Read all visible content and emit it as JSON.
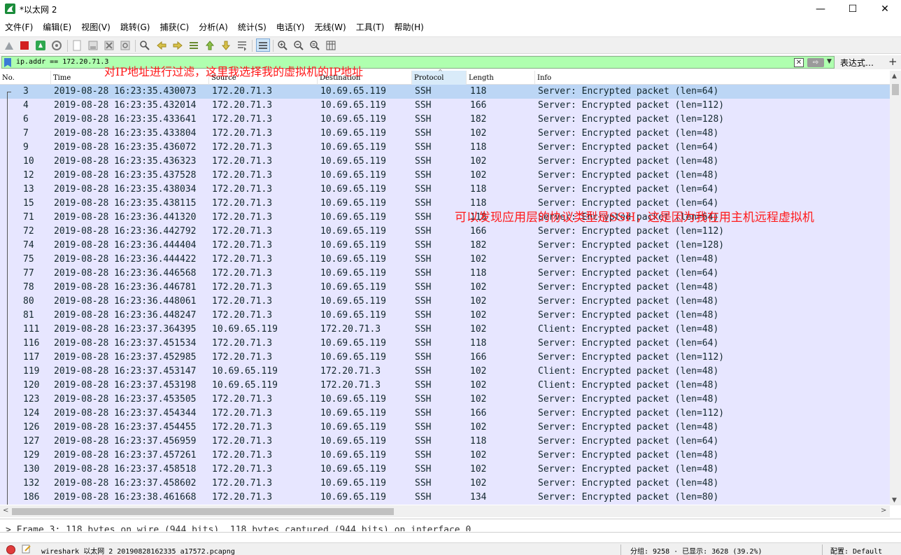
{
  "window": {
    "title": "*以太网 2",
    "min_glyph": "—",
    "max_glyph": "☐",
    "close_glyph": "✕"
  },
  "menu": [
    "文件(F)",
    "编辑(E)",
    "视图(V)",
    "跳转(G)",
    "捕获(C)",
    "分析(A)",
    "统计(S)",
    "电话(Y)",
    "无线(W)",
    "工具(T)",
    "帮助(H)"
  ],
  "toolbar": {
    "icons": [
      "shark-fin-start-icon",
      "stop-capture-icon",
      "restart-capture-icon",
      "capture-options-icon",
      "open-file-icon",
      "save-file-icon",
      "close-file-icon",
      "reload-file-icon",
      "find-packet-icon",
      "go-back-icon",
      "go-forward-icon",
      "go-to-packet-icon",
      "go-first-packet-icon",
      "go-last-packet-icon",
      "auto-scroll-icon",
      "colorize-icon",
      "zoom-in-icon",
      "zoom-out-icon",
      "zoom-normal-icon",
      "resize-columns-icon"
    ]
  },
  "filter": {
    "value": "ip.addr == 172.20.71.3",
    "clear_glyph": "✕",
    "apply_glyph": "⇨",
    "dropdown_glyph": "▼",
    "expression_label": "表达式…",
    "add_glyph": "+",
    "background_color": "#afffaf"
  },
  "columns": [
    "No.",
    "Time",
    "Source",
    "Destination",
    "Protocol",
    "Length",
    "Info"
  ],
  "packets": [
    {
      "no": "3",
      "time": "2019-08-28 16:23:35.430073",
      "src": "172.20.71.3",
      "dst": "10.69.65.119",
      "proto": "SSH",
      "len": "118",
      "info": "Server: Encrypted packet (len=64)"
    },
    {
      "no": "4",
      "time": "2019-08-28 16:23:35.432014",
      "src": "172.20.71.3",
      "dst": "10.69.65.119",
      "proto": "SSH",
      "len": "166",
      "info": "Server: Encrypted packet (len=112)"
    },
    {
      "no": "6",
      "time": "2019-08-28 16:23:35.433641",
      "src": "172.20.71.3",
      "dst": "10.69.65.119",
      "proto": "SSH",
      "len": "182",
      "info": "Server: Encrypted packet (len=128)"
    },
    {
      "no": "7",
      "time": "2019-08-28 16:23:35.433804",
      "src": "172.20.71.3",
      "dst": "10.69.65.119",
      "proto": "SSH",
      "len": "102",
      "info": "Server: Encrypted packet (len=48)"
    },
    {
      "no": "9",
      "time": "2019-08-28 16:23:35.436072",
      "src": "172.20.71.3",
      "dst": "10.69.65.119",
      "proto": "SSH",
      "len": "118",
      "info": "Server: Encrypted packet (len=64)"
    },
    {
      "no": "10",
      "time": "2019-08-28 16:23:35.436323",
      "src": "172.20.71.3",
      "dst": "10.69.65.119",
      "proto": "SSH",
      "len": "102",
      "info": "Server: Encrypted packet (len=48)"
    },
    {
      "no": "12",
      "time": "2019-08-28 16:23:35.437528",
      "src": "172.20.71.3",
      "dst": "10.69.65.119",
      "proto": "SSH",
      "len": "102",
      "info": "Server: Encrypted packet (len=48)"
    },
    {
      "no": "13",
      "time": "2019-08-28 16:23:35.438034",
      "src": "172.20.71.3",
      "dst": "10.69.65.119",
      "proto": "SSH",
      "len": "118",
      "info": "Server: Encrypted packet (len=64)"
    },
    {
      "no": "15",
      "time": "2019-08-28 16:23:35.438115",
      "src": "172.20.71.3",
      "dst": "10.69.65.119",
      "proto": "SSH",
      "len": "118",
      "info": "Server: Encrypted packet (len=64)"
    },
    {
      "no": "71",
      "time": "2019-08-28 16:23:36.441320",
      "src": "172.20.71.3",
      "dst": "10.69.65.119",
      "proto": "SSH",
      "len": "118",
      "info": "Server: Encrypted packet (len=64)"
    },
    {
      "no": "72",
      "time": "2019-08-28 16:23:36.442792",
      "src": "172.20.71.3",
      "dst": "10.69.65.119",
      "proto": "SSH",
      "len": "166",
      "info": "Server: Encrypted packet (len=112)"
    },
    {
      "no": "74",
      "time": "2019-08-28 16:23:36.444404",
      "src": "172.20.71.3",
      "dst": "10.69.65.119",
      "proto": "SSH",
      "len": "182",
      "info": "Server: Encrypted packet (len=128)"
    },
    {
      "no": "75",
      "time": "2019-08-28 16:23:36.444422",
      "src": "172.20.71.3",
      "dst": "10.69.65.119",
      "proto": "SSH",
      "len": "102",
      "info": "Server: Encrypted packet (len=48)"
    },
    {
      "no": "77",
      "time": "2019-08-28 16:23:36.446568",
      "src": "172.20.71.3",
      "dst": "10.69.65.119",
      "proto": "SSH",
      "len": "118",
      "info": "Server: Encrypted packet (len=64)"
    },
    {
      "no": "78",
      "time": "2019-08-28 16:23:36.446781",
      "src": "172.20.71.3",
      "dst": "10.69.65.119",
      "proto": "SSH",
      "len": "102",
      "info": "Server: Encrypted packet (len=48)"
    },
    {
      "no": "80",
      "time": "2019-08-28 16:23:36.448061",
      "src": "172.20.71.3",
      "dst": "10.69.65.119",
      "proto": "SSH",
      "len": "102",
      "info": "Server: Encrypted packet (len=48)"
    },
    {
      "no": "81",
      "time": "2019-08-28 16:23:36.448247",
      "src": "172.20.71.3",
      "dst": "10.69.65.119",
      "proto": "SSH",
      "len": "102",
      "info": "Server: Encrypted packet (len=48)"
    },
    {
      "no": "111",
      "time": "2019-08-28 16:23:37.364395",
      "src": "10.69.65.119",
      "dst": "172.20.71.3",
      "proto": "SSH",
      "len": "102",
      "info": "Client: Encrypted packet (len=48)"
    },
    {
      "no": "116",
      "time": "2019-08-28 16:23:37.451534",
      "src": "172.20.71.3",
      "dst": "10.69.65.119",
      "proto": "SSH",
      "len": "118",
      "info": "Server: Encrypted packet (len=64)"
    },
    {
      "no": "117",
      "time": "2019-08-28 16:23:37.452985",
      "src": "172.20.71.3",
      "dst": "10.69.65.119",
      "proto": "SSH",
      "len": "166",
      "info": "Server: Encrypted packet (len=112)"
    },
    {
      "no": "119",
      "time": "2019-08-28 16:23:37.453147",
      "src": "10.69.65.119",
      "dst": "172.20.71.3",
      "proto": "SSH",
      "len": "102",
      "info": "Client: Encrypted packet (len=48)"
    },
    {
      "no": "120",
      "time": "2019-08-28 16:23:37.453198",
      "src": "10.69.65.119",
      "dst": "172.20.71.3",
      "proto": "SSH",
      "len": "102",
      "info": "Client: Encrypted packet (len=48)"
    },
    {
      "no": "123",
      "time": "2019-08-28 16:23:37.453505",
      "src": "172.20.71.3",
      "dst": "10.69.65.119",
      "proto": "SSH",
      "len": "102",
      "info": "Server: Encrypted packet (len=48)"
    },
    {
      "no": "124",
      "time": "2019-08-28 16:23:37.454344",
      "src": "172.20.71.3",
      "dst": "10.69.65.119",
      "proto": "SSH",
      "len": "166",
      "info": "Server: Encrypted packet (len=112)"
    },
    {
      "no": "126",
      "time": "2019-08-28 16:23:37.454455",
      "src": "172.20.71.3",
      "dst": "10.69.65.119",
      "proto": "SSH",
      "len": "102",
      "info": "Server: Encrypted packet (len=48)"
    },
    {
      "no": "127",
      "time": "2019-08-28 16:23:37.456959",
      "src": "172.20.71.3",
      "dst": "10.69.65.119",
      "proto": "SSH",
      "len": "118",
      "info": "Server: Encrypted packet (len=64)"
    },
    {
      "no": "129",
      "time": "2019-08-28 16:23:37.457261",
      "src": "172.20.71.3",
      "dst": "10.69.65.119",
      "proto": "SSH",
      "len": "102",
      "info": "Server: Encrypted packet (len=48)"
    },
    {
      "no": "130",
      "time": "2019-08-28 16:23:37.458518",
      "src": "172.20.71.3",
      "dst": "10.69.65.119",
      "proto": "SSH",
      "len": "102",
      "info": "Server: Encrypted packet (len=48)"
    },
    {
      "no": "132",
      "time": "2019-08-28 16:23:37.458602",
      "src": "172.20.71.3",
      "dst": "10.69.65.119",
      "proto": "SSH",
      "len": "102",
      "info": "Server: Encrypted packet (len=48)"
    },
    {
      "no": "186",
      "time": "2019-08-28 16:23:38.461668",
      "src": "172.20.71.3",
      "dst": "10.69.65.119",
      "proto": "SSH",
      "len": "134",
      "info": "Server: Encrypted packet (len=80)"
    }
  ],
  "selected_packet": "3",
  "row_colors": {
    "ssh_row": "#e7e6ff",
    "selected_row": "#bcd6f5",
    "row_text": "#12272e"
  },
  "details": {
    "expander_glyph": ">",
    "frame_line": "Frame 3: 118 bytes on wire (944 bits), 118 bytes captured (944 bits) on interface 0"
  },
  "status": {
    "file": "wireshark_以太网 2_20190828162335_a17572.pcapng",
    "stats": "分组: 9258 · 已显示: 3628 (39.2%)",
    "profile": "配置: Default"
  },
  "annotations": {
    "note1": "对IP地址进行过滤，这里我选择我的虚拟机的IP地址",
    "note2": "可以发现应用层的协议类型是SSH，这是因为我在用主机远程虚拟机",
    "color": "#ff1a1a"
  }
}
